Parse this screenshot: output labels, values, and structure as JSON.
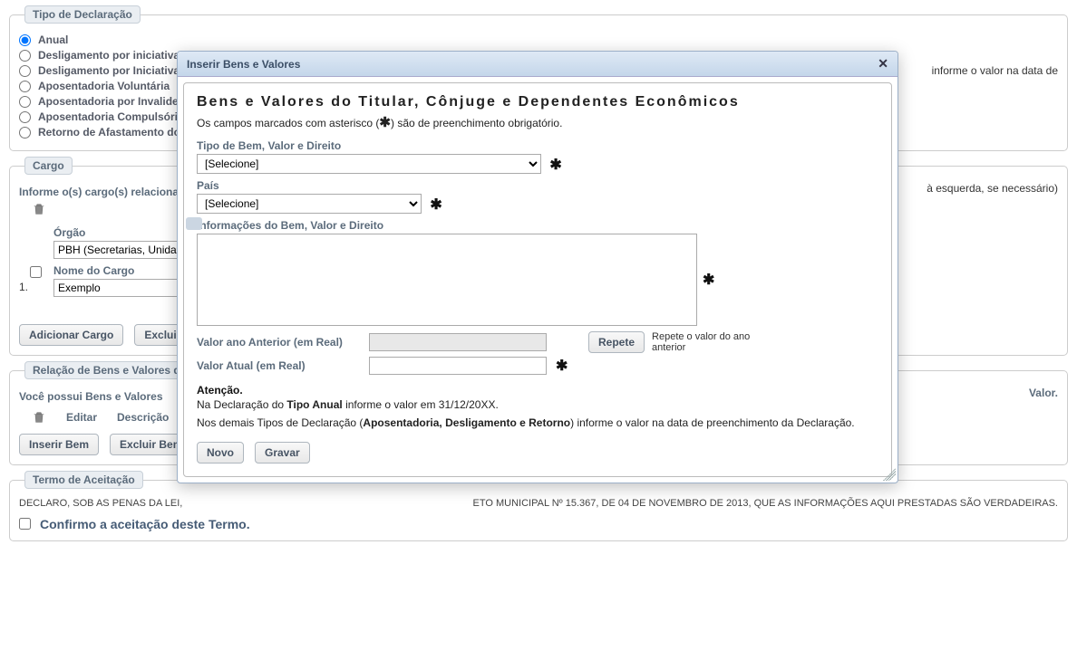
{
  "tipo_declaracao": {
    "legend": "Tipo de Declaração",
    "opts": [
      "Anual",
      "Desligamento por iniciativa própria",
      "Desligamento por Iniciativa da Administração Pública",
      "Aposentadoria Voluntária",
      "Aposentadoria por Invalidez",
      "Aposentadoria Compulsória",
      "Retorno de Afastamento do Cargo"
    ],
    "hint_right": "informe o valor na data de"
  },
  "cargo": {
    "legend": "Cargo",
    "helper": "Informe o(s) cargo(s) relacionados",
    "row_idx": "1.",
    "orgao_label": "Órgão",
    "orgao_value": "PBH (Secretarias, Unidades)",
    "nome_label": "Nome do Cargo",
    "nome_value": "Exemplo",
    "add_btn": "Adicionar Cargo",
    "del_btn": "Excluir",
    "scroll_hint_right": "à esquerda, se necessário)"
  },
  "bens": {
    "legend": "Relação de Bens e Valores do Titular",
    "question": "Você possui Bens e Valores",
    "value_label_right": "Valor.",
    "col_edit": "Editar",
    "col_desc": "Descrição",
    "insert_btn": "Inserir Bem",
    "delete_btn": "Excluir Bem"
  },
  "termo": {
    "legend": "Termo de Aceitação",
    "text_a": "DECLARO, SOB AS PENAS DA LEI,",
    "text_b": "ETO MUNICIPAL Nº 15.367, DE 04 DE NOVEMBRO DE 2013, QUE AS INFORMAÇÕES AQUI PRESTADAS SÃO VERDADEIRAS.",
    "confirm": "Confirmo a aceitação deste Termo."
  },
  "modal": {
    "title": "Inserir Bens e Valores",
    "heading": "Bens e Valores do Titular, Cônjuge e Dependentes Econômicos",
    "sub_a": "Os campos marcados com asterisco (",
    "sub_b": ") são de preenchimento obrigatório.",
    "tipo_label": "Tipo de Bem, Valor e Direito",
    "tipo_sel": "[Selecione]",
    "pais_label": "País",
    "pais_sel": "[Selecione]",
    "info_label": "Informações do Bem, Valor e Direito",
    "val_ant_label": "Valor ano Anterior (em Real)",
    "val_atual_label": "Valor Atual (em Real)",
    "repete_btn": "Repete",
    "repete_hint": "Repete o valor do ano anterior",
    "attn": "Atenção.",
    "attn_line1_a": "Na Declaração do ",
    "attn_line1_b": "Tipo Anual",
    "attn_line1_c": " informe o valor em 31/12/20XX.",
    "attn_line2_a": "Nos demais Tipos de Declaração (",
    "attn_line2_b": "Aposentadoria, Desligamento e Retorno",
    "attn_line2_c": ") informe o valor na data de preenchimento da Declaração.",
    "novo_btn": "Novo",
    "gravar_btn": "Gravar"
  }
}
